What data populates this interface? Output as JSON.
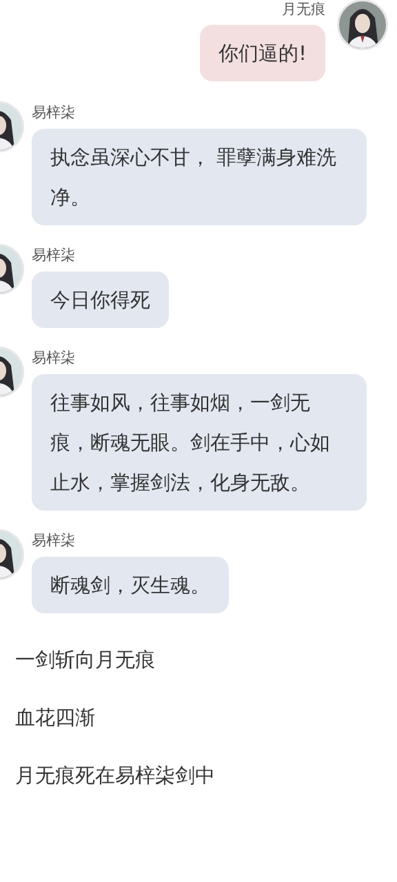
{
  "messages": [
    {
      "kind": "outgoing",
      "sender": "月无痕",
      "text": "你们逼的!"
    },
    {
      "kind": "incoming",
      "sender": "易梓柒",
      "text": "执念虽深心不甘， 罪孽满身难洗净。"
    },
    {
      "kind": "incoming",
      "sender": "易梓柒",
      "text": "今日你得死"
    },
    {
      "kind": "incoming",
      "sender": "易梓柒",
      "text": "往事如风，往事如烟，一剑无痕，断魂无眼。剑在手中，心如止水，掌握剑法，化身无敌。"
    },
    {
      "kind": "incoming",
      "sender": "易梓柒",
      "text": "断魂剑，灭生魂。"
    },
    {
      "kind": "narration",
      "text": "一剑斩向月无痕"
    },
    {
      "kind": "narration",
      "text": "血花四渐"
    },
    {
      "kind": "narration",
      "text": "月无痕死在易梓柒剑中"
    }
  ]
}
